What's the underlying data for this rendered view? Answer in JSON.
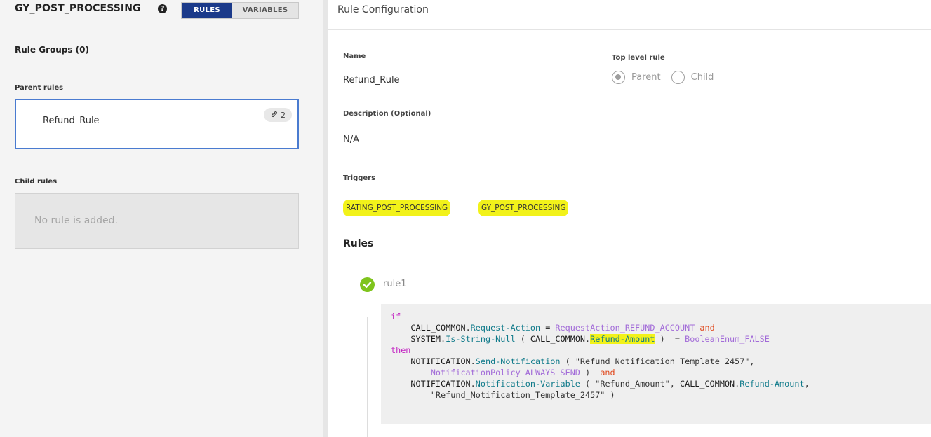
{
  "left": {
    "app_title": "GY_POST_PROCESSING",
    "help_icon": "?",
    "tabs": [
      "RULES",
      "VARIABLES"
    ],
    "rule_groups": "Rule Groups (0)",
    "parent_rules_label": "Parent rules",
    "parent_rule": {
      "name": "Refund_Rule",
      "links": "2"
    },
    "child_rules_label": "Child rules",
    "child_empty": "No rule is added."
  },
  "right": {
    "header": "Rule Configuration",
    "name_label": "Name",
    "name_value": "Refund_Rule",
    "top_level_label": "Top level rule",
    "radio_parent": "Parent",
    "radio_child": "Child",
    "radio_selected": "Parent",
    "description_label": "Description (Optional)",
    "description_value": "N/A",
    "triggers_label": "Triggers",
    "triggers": [
      "RATING_POST_PROCESSING",
      "GY_POST_PROCESSING"
    ],
    "rules_title": "Rules",
    "rule_name": "rule1"
  },
  "code": {
    "if": "if",
    "then": "then",
    "and": "and",
    "l1_obj": "CALL_COMMON",
    "l1_mem": "Request-Action",
    "l1_op": " = ",
    "l1_enum": "RequestAction_REFUND_ACCOUNT",
    "l2_obj": "SYSTEM",
    "l2_mem": "Is-String-Null",
    "l2_arg_obj": "CALL_COMMON",
    "l2_arg_mem": "Refund-Amount",
    "l2_enum": "BooleanEnum_FALSE",
    "l3_obj": "NOTIFICATION",
    "l3_mem": "Send-Notification",
    "l3_str": "\"Refund_Notification_Template_2457\"",
    "l4_enum": "NotificationPolicy_ALWAYS_SEND",
    "l5_obj": "NOTIFICATION",
    "l5_mem": "Notification-Variable",
    "l5_str": "\"Refund_Amount\"",
    "l5_arg_obj": "CALL_COMMON",
    "l5_arg_mem": "Refund-Amount",
    "l6_str": "\"Refund_Notification_Template_2457\""
  },
  "colors": {
    "accent": "#1b3a8a",
    "highlight": "#f2f21a",
    "success": "#7fc41d",
    "keyword": "#c222c2",
    "member": "#0f7a8a",
    "enum": "#a26bd8",
    "and": "#e04a1f"
  }
}
